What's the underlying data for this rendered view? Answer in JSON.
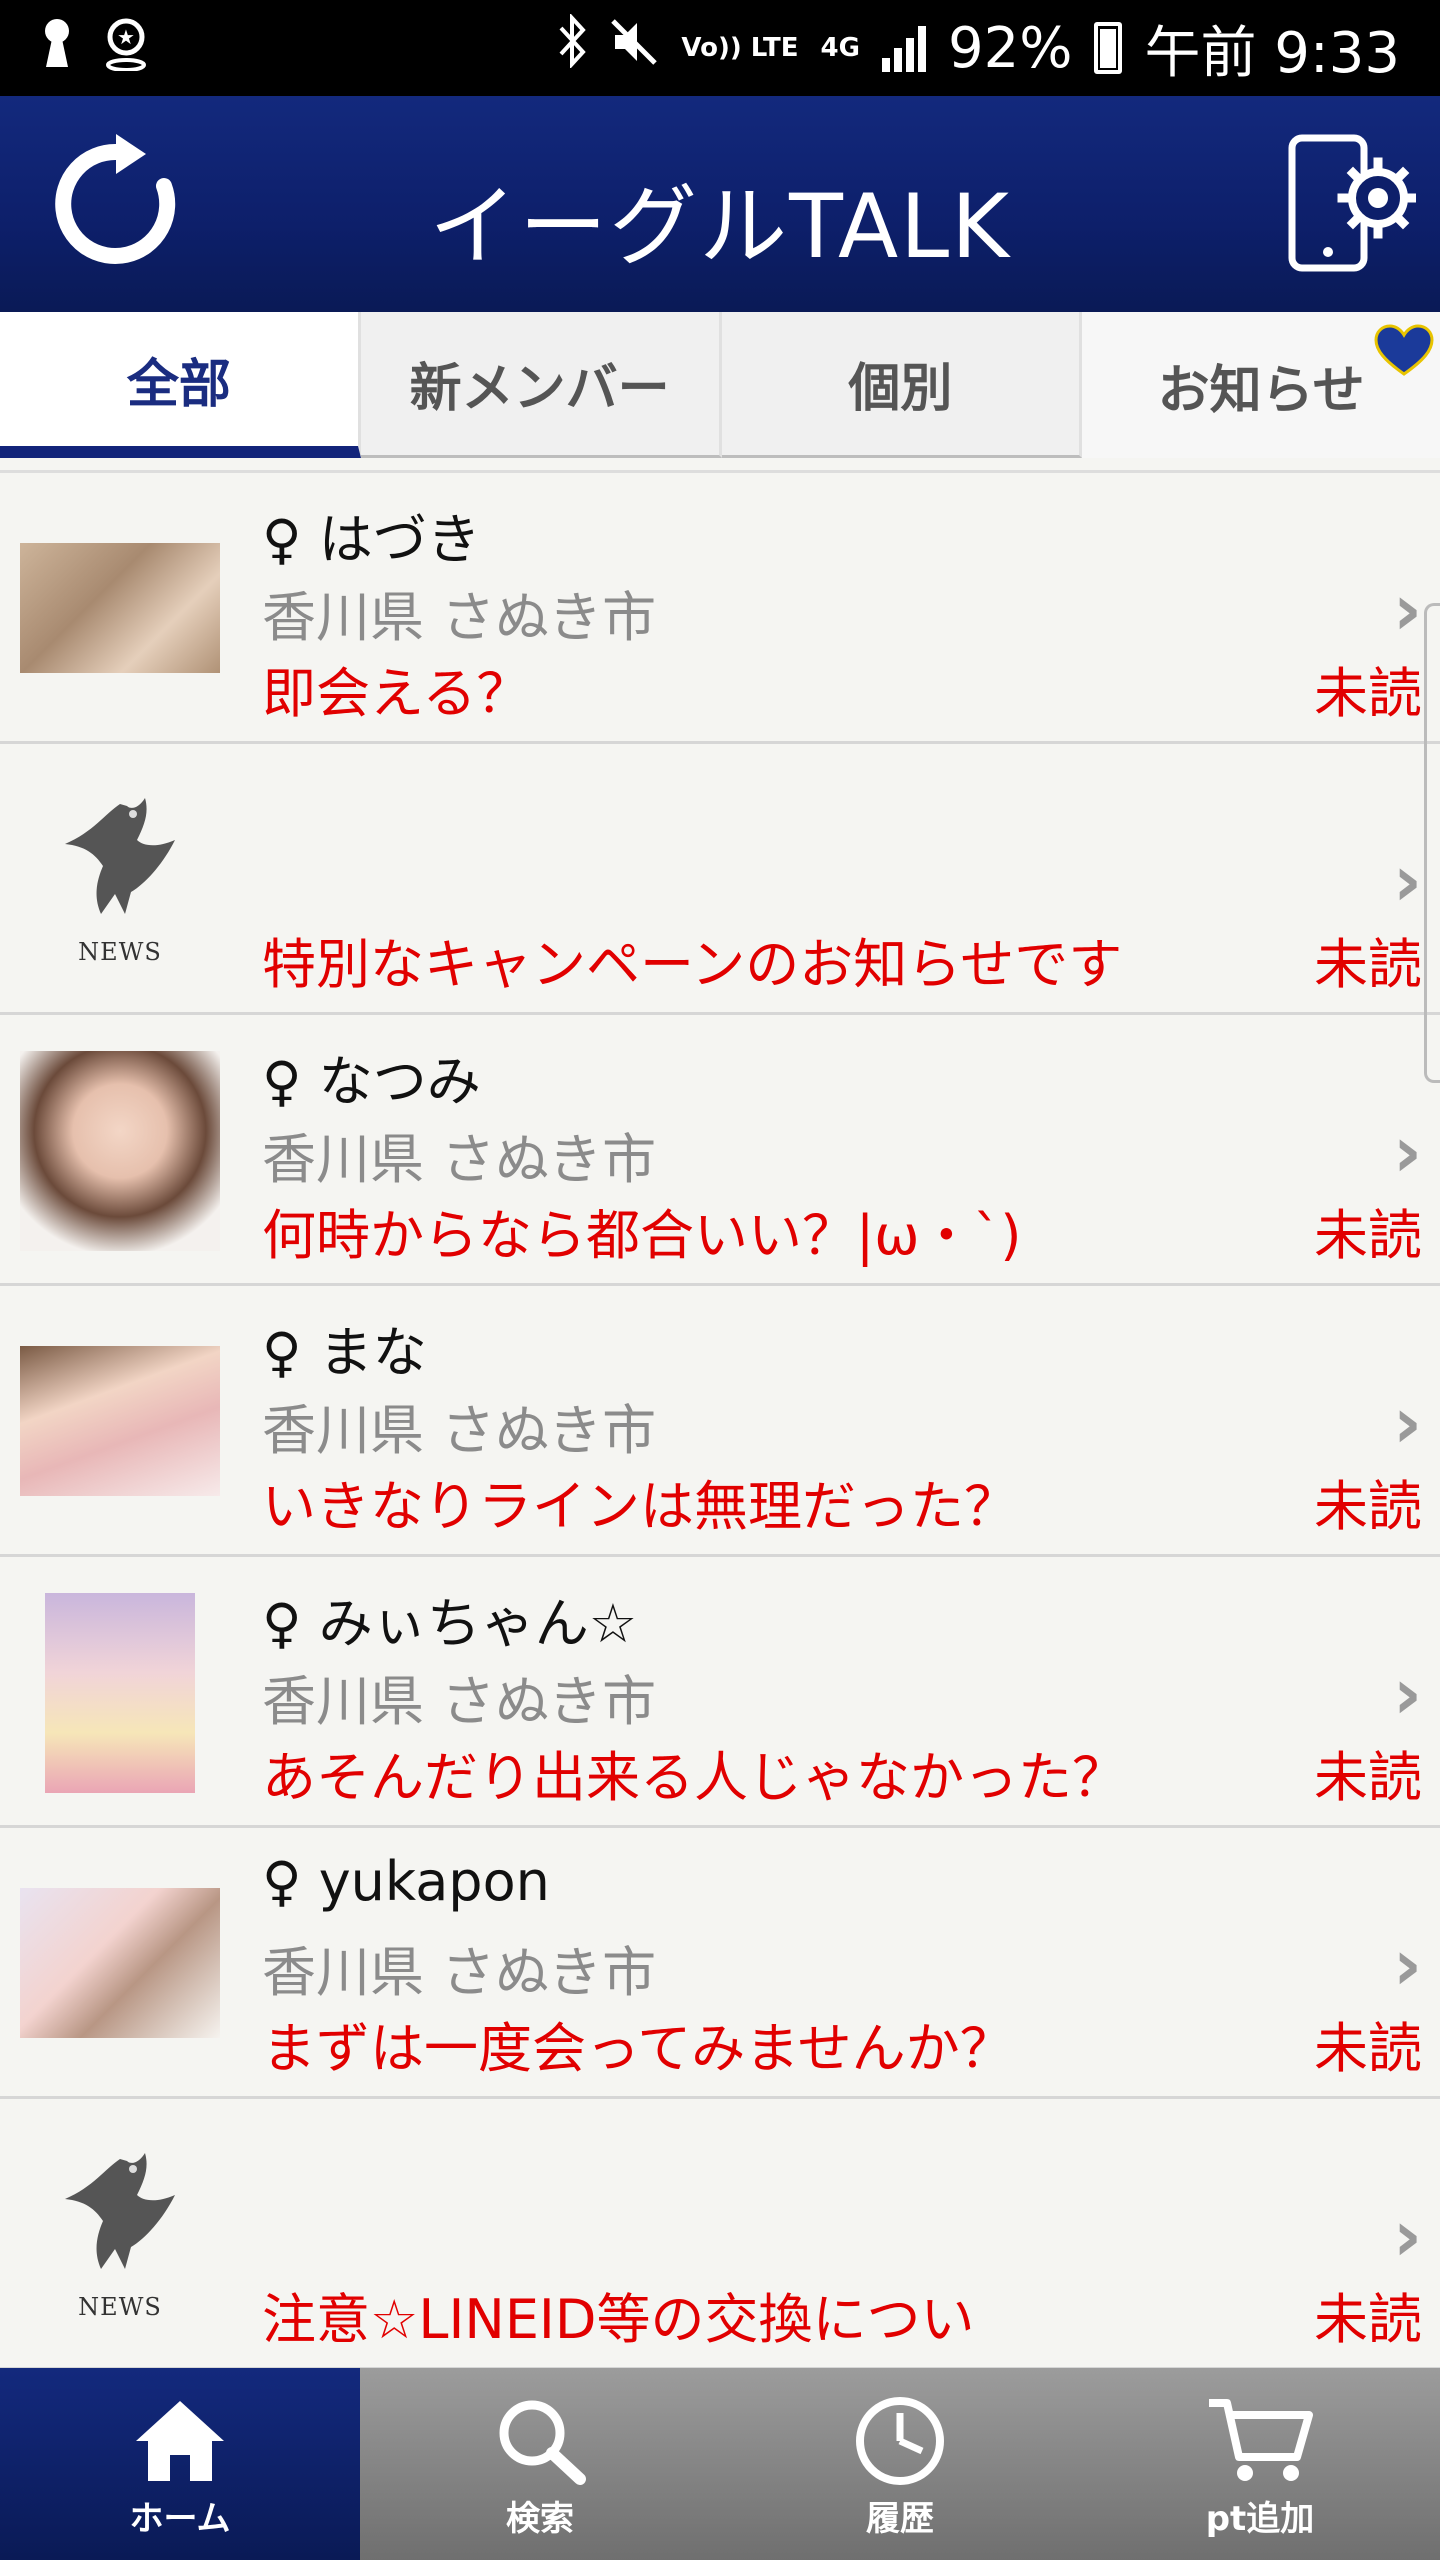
{
  "status_bar": {
    "battery": "92%",
    "time": "午前 9:33",
    "network": "4G",
    "volte": "Vo)) LTE"
  },
  "header": {
    "title": "イーグルTALK",
    "refresh_icon": "refresh-icon",
    "settings_icon": "phone-settings-icon"
  },
  "tabs": [
    {
      "label": "全部",
      "active": true
    },
    {
      "label": "新メンバー",
      "active": false
    },
    {
      "label": "個別",
      "active": false
    },
    {
      "label": "お知らせ",
      "active": false,
      "badge_icon": "heart-icon"
    }
  ],
  "messages": [
    {
      "type": "user",
      "name": "♀ はづき",
      "location": "香川県 さぬき市",
      "message": "即会える？",
      "status": "未読"
    },
    {
      "type": "news",
      "label": "NEWS",
      "message": "特別なキャンペーンのお知らせです",
      "status": "未読"
    },
    {
      "type": "user",
      "name": "♀ なつみ",
      "location": "香川県 さぬき市",
      "message": "何時からなら都合いい？|ω・`)",
      "status": "未読"
    },
    {
      "type": "user",
      "name": "♀ まな",
      "location": "香川県 さぬき市",
      "message": "いきなりラインは無理だった？",
      "status": "未読"
    },
    {
      "type": "user",
      "name": "♀ みぃちゃん☆",
      "location": "香川県 さぬき市",
      "message": "あそんだり出来る人じゃなかった？",
      "status": "未読"
    },
    {
      "type": "user",
      "name": "♀ yukapon",
      "location": "香川県 さぬき市",
      "message": "まずは一度会ってみませんか？",
      "status": "未読"
    },
    {
      "type": "news",
      "label": "NEWS",
      "message": "注意☆LINEID等の交換につい",
      "status": "未読"
    }
  ],
  "bottom_nav": [
    {
      "label": "ホーム",
      "icon": "home-icon",
      "active": true
    },
    {
      "label": "検索",
      "icon": "search-icon",
      "active": false
    },
    {
      "label": "履歴",
      "icon": "clock-icon",
      "active": false
    },
    {
      "label": "pt追加",
      "icon": "cart-icon",
      "active": false
    }
  ],
  "colors": {
    "header": "#0d1f6a",
    "accent_red": "#e10000",
    "nav_inactive": "#8a8a8a"
  }
}
